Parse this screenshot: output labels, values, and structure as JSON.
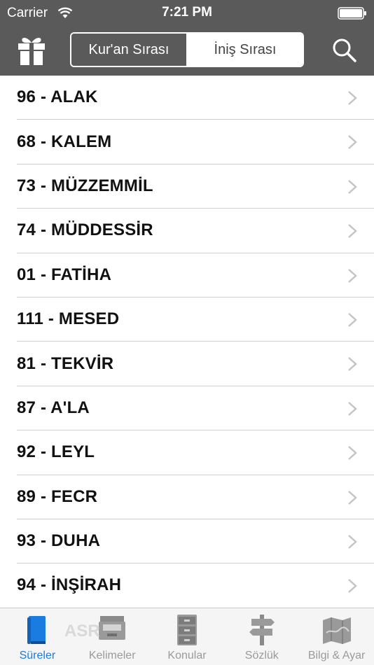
{
  "status": {
    "carrier": "Carrier",
    "time": "7:21 PM"
  },
  "nav": {
    "segments": [
      "Kur'an Sırası",
      "İniş Sırası"
    ],
    "selected_segment": "Kur'an Sırası"
  },
  "list": [
    "96 - ALAK",
    "68 - KALEM",
    "73 - MÜZZEMMİL",
    "74 - MÜDDESSİR",
    "01 - FATİHA",
    "111 - MESED",
    "81 - TEKVİR",
    "87 - A'LA",
    "92 - LEYL",
    "89 - FECR",
    "93 - DUHA",
    "94 - İNŞİRAH"
  ],
  "partial_row": "ASR",
  "tabs": [
    {
      "label": "Süreler",
      "icon": "book-icon"
    },
    {
      "label": "Kelimeler",
      "icon": "inbox-tray-icon"
    },
    {
      "label": "Konular",
      "icon": "file-cabinet-icon"
    },
    {
      "label": "Sözlük",
      "icon": "signpost-icon"
    },
    {
      "label": "Bilgi & Ayar",
      "icon": "map-icon"
    }
  ],
  "selected_tab": "Süreler",
  "colors": {
    "nav_background": "#5a5a5a",
    "accent": "#1a7be0",
    "tab_inactive": "#9a9a9a"
  }
}
